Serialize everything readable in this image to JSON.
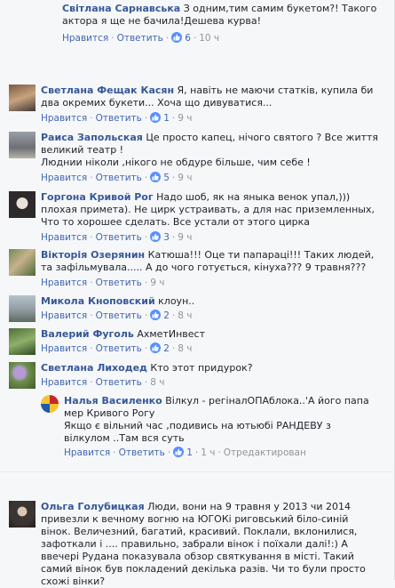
{
  "ui": {
    "like": "Нравится",
    "reply": "Ответить",
    "sep": "·",
    "edited": "Отредактирован"
  },
  "comments": [
    {
      "name": "Світлана Сарнавська",
      "text": " З одним,тим самим букетом?! Такого актора я ще не бачила!Дешева курва!",
      "likes": "6",
      "time": "10 ч"
    },
    {
      "name": "Светлана Фещак Касян",
      "text": " Я, навіть не маючи статків, купила би два окремих букети... Хоча що дивуватися...",
      "likes": "1",
      "time": "9 ч"
    },
    {
      "name": "Раиса Запольская",
      "text": " Це просто капец, нічого святого ? Все життя великий театр !",
      "text2": "Люднии ніколи ,нікого не обдуре більше, чим себе !",
      "likes": "5",
      "time": "9 ч"
    },
    {
      "name": "Горгона Кривой Рог",
      "text": " Надо шоб, як на яныка венок упал,))) плохая примета). Не цирк устраивать, а для нас приземленных, Что то хорошее сделать. Все устали от этого цирка",
      "likes": "3",
      "time": "9 ч"
    },
    {
      "name": "Вікторія Озерянин",
      "text": " Катюша!!! Оце ти папараці!!! Таких людей, та зафільмувала..... А до чого готується, кінуха??? 9 травня???",
      "likes": "",
      "time": "9 ч"
    },
    {
      "name": "Микола Кноповский",
      "text": " клоун..",
      "likes": "2",
      "time": "8 ч"
    },
    {
      "name": "Валерий Фуголь",
      "text": " АхметИнвест",
      "likes": "2",
      "time": "8 ч"
    },
    {
      "name": "Светлана Лиходед",
      "text": " Кто этот придурок?",
      "likes": "",
      "time": "8 ч"
    },
    {
      "name": "Налья Василенко",
      "text": " Вілкул - регіналОПАблока..'А його папа мер Кривого Рогу",
      "text2": "Якщо є вільний час ,подивись на ютьюбі РАНДЕВУ з вілкулом ..Там вся суть",
      "likes": "1",
      "time": "1 ч"
    },
    {
      "name": "Ольга Голубицкая",
      "text": " Люди, вони на 9 травня у 2013 чи 2014 привезли к вечному вогню на ЮГОКі риговський біло-синій вінок. Величезний, багатий, красивий. Поклали, вклонилися, зафоткали і .... правильно, забрали вінок і поїхали далі!:) А ввечері Рудана показувала обзор святкування в місті. Такий самий вінок був покладений декілька разів. Чи то були просто схожі вінки?"
    }
  ]
}
